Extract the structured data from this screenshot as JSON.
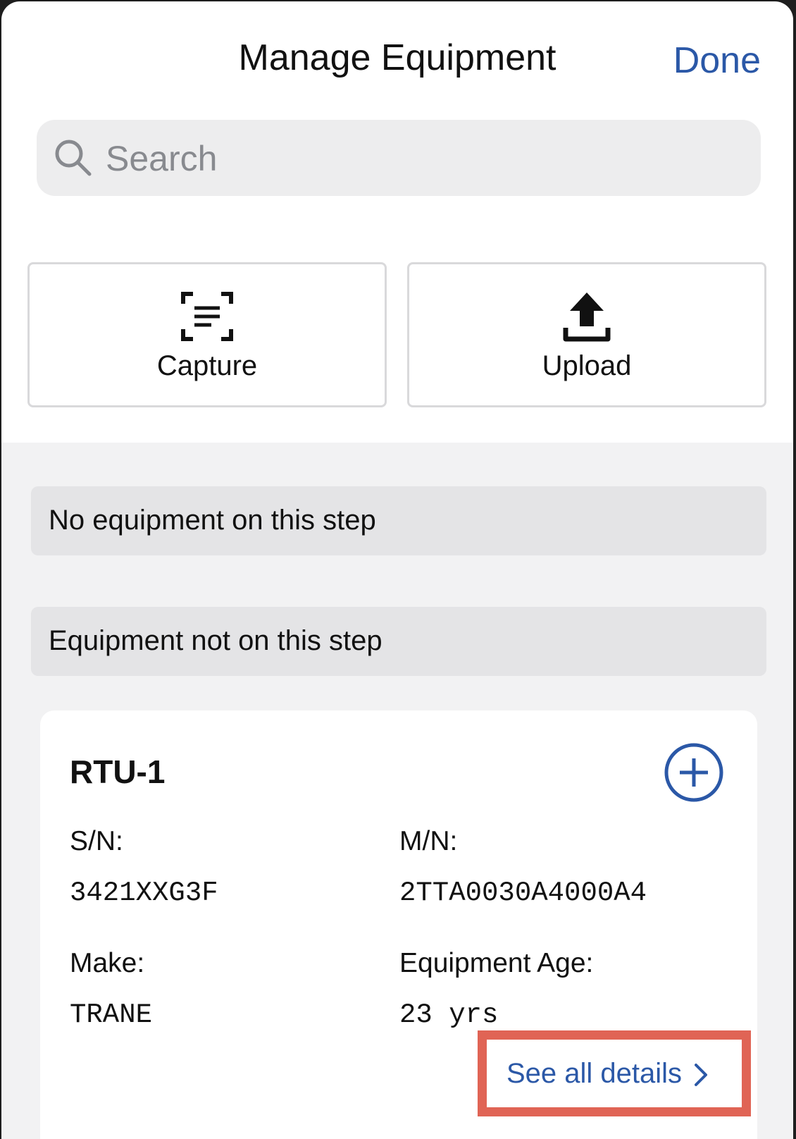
{
  "header": {
    "title": "Manage Equipment",
    "done_label": "Done"
  },
  "search": {
    "placeholder": "Search",
    "value": ""
  },
  "actions": {
    "capture_label": "Capture",
    "upload_label": "Upload"
  },
  "sections": {
    "on_step_empty": "No equipment on this step",
    "not_on_step": "Equipment not on this step"
  },
  "equipment": {
    "name": "RTU-1",
    "sn_label": "S/N:",
    "sn_value": "3421XXG3F",
    "mn_label": "M/N:",
    "mn_value": "2TTA0030A4000A4",
    "make_label": "Make:",
    "make_value": "TRANE",
    "age_label": "Equipment Age:",
    "age_value": "23 yrs",
    "details_link": "See all details"
  },
  "colors": {
    "accent": "#2b58a7",
    "highlight": "#e06455",
    "search_bg": "#ededee",
    "section_bg": "#e4e4e6"
  },
  "icons": {
    "search": "search-icon",
    "capture": "scan-document-icon",
    "upload": "upload-icon",
    "add": "add-circle-icon",
    "chevron": "chevron-right-icon"
  }
}
